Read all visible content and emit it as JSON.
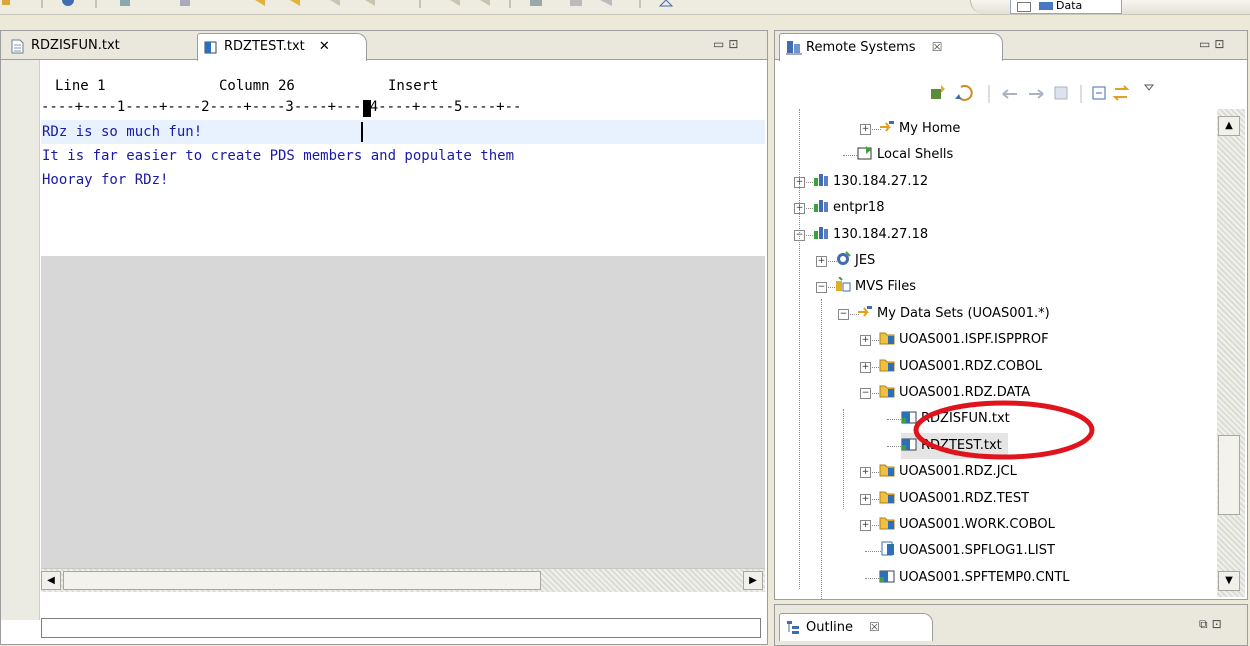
{
  "perspective": {
    "label": "Data"
  },
  "editor": {
    "tabs": [
      {
        "label": "RDZISFUN.txt",
        "active": false
      },
      {
        "label": "RDZTEST.txt",
        "active": true
      }
    ],
    "status": {
      "line": "Line 1",
      "column": "Column 26",
      "mode": "Insert"
    },
    "ruler": "----+----1----+----2----+----3----+----4----+----5----+--",
    "lines": [
      "RDz is so much fun!",
      "It is far easier to create PDS members and populate them",
      "Hooray for RDz!"
    ],
    "command_value": ""
  },
  "remote": {
    "title": "Remote Systems",
    "close_glyph": "☒",
    "tree": [
      {
        "label": "My Home",
        "icon": "filter-icon",
        "expander": "+"
      },
      {
        "label": "Local Shells",
        "icon": "shells-icon",
        "expander": ""
      },
      {
        "label": "130.184.27.12",
        "icon": "host-icon",
        "expander": "+"
      },
      {
        "label": "entpr18",
        "icon": "host-icon",
        "expander": "+"
      },
      {
        "label": "130.184.27.18",
        "icon": "host-icon",
        "expander": "−"
      },
      {
        "label": "JES",
        "icon": "jes-icon",
        "expander": "+"
      },
      {
        "label": "MVS Files",
        "icon": "mvs-files-icon",
        "expander": "−"
      },
      {
        "label": "My Data Sets (UOAS001.*)",
        "icon": "filter-icon",
        "expander": "−"
      },
      {
        "label": "UOAS001.ISPF.ISPPROF",
        "icon": "pds-folder-icon",
        "expander": "+"
      },
      {
        "label": "UOAS001.RDZ.COBOL",
        "icon": "pds-folder-icon",
        "expander": "+"
      },
      {
        "label": "UOAS001.RDZ.DATA",
        "icon": "pds-folder-icon",
        "expander": "−"
      },
      {
        "label": "RDZISFUN.txt",
        "icon": "member-icon",
        "expander": ""
      },
      {
        "label": "RDZTEST.txt",
        "icon": "member-icon",
        "expander": ""
      },
      {
        "label": "UOAS001.RDZ.JCL",
        "icon": "pds-folder-icon",
        "expander": "+"
      },
      {
        "label": "UOAS001.RDZ.TEST",
        "icon": "pds-folder-icon",
        "expander": "+"
      },
      {
        "label": "UOAS001.WORK.COBOL",
        "icon": "pds-folder-icon",
        "expander": "+"
      },
      {
        "label": "UOAS001.SPFLOG1.LIST",
        "icon": "sequential-file-icon",
        "expander": ""
      },
      {
        "label": "UOAS001.SPFTEMP0.CNTL",
        "icon": "member-icon",
        "expander": ""
      }
    ]
  },
  "outline": {
    "title": "Outline",
    "close_glyph": "☒"
  },
  "colors": {
    "highlight_ellipse": "#e0141c",
    "editor_text": "#1a1aa6",
    "current_line": "#e8f2fe"
  }
}
